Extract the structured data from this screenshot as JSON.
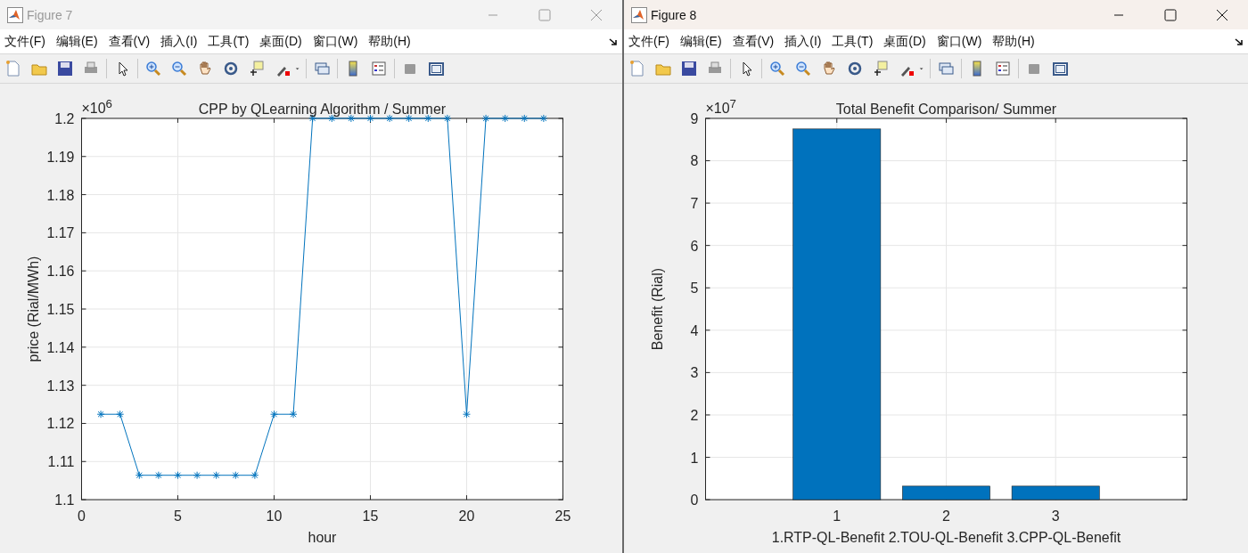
{
  "windows": [
    {
      "title": "Figure 7",
      "active": false,
      "menus": [
        "文件(F)",
        "编辑(E)",
        "查看(V)",
        "插入(I)",
        "工具(T)",
        "桌面(D)",
        "窗口(W)",
        "帮助(H)"
      ],
      "figure": {
        "exponent_label": "×10$^{6}$",
        "chart_data": {
          "type": "line",
          "title": "CPP by QLearning Algorithm / Summer",
          "xlabel": "hour",
          "ylabel": "price (Rial/MWh)",
          "x": [
            1,
            2,
            3,
            4,
            5,
            6,
            7,
            8,
            9,
            10,
            11,
            12,
            13,
            14,
            15,
            16,
            17,
            18,
            19,
            20,
            21,
            22,
            23,
            24
          ],
          "series": [
            {
              "color": "#0072bd",
              "marker": "cross",
              "values": [
                1.1224,
                1.1224,
                1.1064,
                1.1064,
                1.1064,
                1.1064,
                1.1064,
                1.1064,
                1.1064,
                1.1224,
                1.1224,
                1.2,
                1.2,
                1.2,
                1.2,
                1.2,
                1.2,
                1.2,
                1.2,
                1.1224,
                1.2,
                1.2,
                1.2,
                1.2
              ]
            }
          ],
          "grid": true,
          "xlim": [
            0,
            25
          ],
          "ylim": [
            1.1,
            1.2
          ],
          "xticks": [
            0,
            5,
            10,
            15,
            20,
            25
          ],
          "yticks": [
            {
              "value": 1.1,
              "label": "1.1"
            },
            {
              "value": 1.11,
              "label": "1.11"
            },
            {
              "value": 1.12,
              "label": "1.12"
            },
            {
              "value": 1.13,
              "label": "1.13"
            },
            {
              "value": 1.14,
              "label": "1.14"
            },
            {
              "value": 1.15,
              "label": "1.15"
            },
            {
              "value": 1.16,
              "label": "1.16"
            },
            {
              "value": 1.17,
              "label": "1.17"
            },
            {
              "value": 1.18,
              "label": "1.18"
            },
            {
              "value": 1.19,
              "label": "1.19"
            },
            {
              "value": 1.2,
              "label": "1.2"
            }
          ]
        }
      }
    },
    {
      "title": "Figure 8",
      "active": true,
      "menus": [
        "文件(F)",
        "编辑(E)",
        "查看(V)",
        "插入(I)",
        "工具(T)",
        "桌面(D)",
        "窗口(W)",
        "帮助(H)"
      ],
      "figure": {
        "exponent_label": "×10$^{7}$",
        "chart_data": {
          "type": "bar",
          "title": "Total Benefit Comparison/ Summer",
          "xlabel": "1.RTP-QL-Benefit 2.TOU-QL-Benefit 3.CPP-QL-Benefit",
          "ylabel": "Benefit (Rial)",
          "categories": [
            "1",
            "2",
            "3"
          ],
          "series": [
            {
              "color": "#0072bd",
              "values": [
                8.75,
                0.32,
                0.32
              ]
            }
          ],
          "grid": true,
          "ylim": [
            0,
            9
          ],
          "yticks": [
            0,
            1,
            2,
            3,
            4,
            5,
            6,
            7,
            8,
            9
          ]
        }
      }
    }
  ]
}
